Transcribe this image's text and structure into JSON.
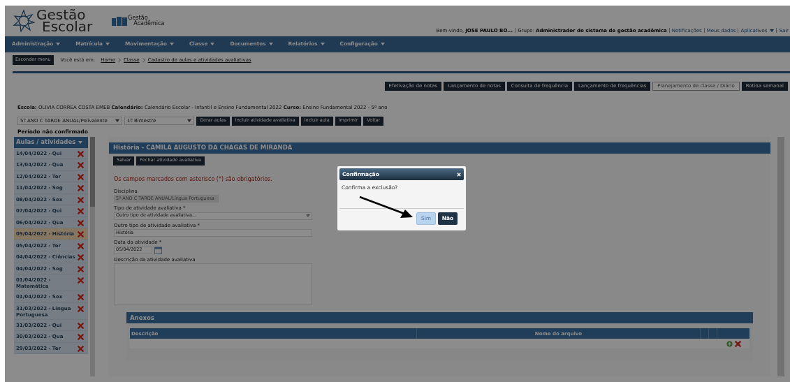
{
  "header": {
    "logo_line_1": "Gestão",
    "logo_line_2": "Escolar",
    "app_line_1": "Gestão",
    "app_line_2": "Acadêmica",
    "welcome_label": "Bem-vindo,",
    "user_name": "JOSE PAULO BO...",
    "group_label": "Grupo:",
    "group_name": "Administrador do sistema de gestão acadêmica",
    "links": [
      {
        "label": "Notificações",
        "dropdown": false
      },
      {
        "label": "Meus dados",
        "dropdown": false
      },
      {
        "label": "Aplicativos",
        "dropdown": true
      },
      {
        "label": "Sair",
        "dropdown": false
      }
    ]
  },
  "nav": [
    {
      "label": "Administração"
    },
    {
      "label": "Matrícula"
    },
    {
      "label": "Movimentação"
    },
    {
      "label": "Classe"
    },
    {
      "label": "Documentos"
    },
    {
      "label": "Relatórios"
    },
    {
      "label": "Configuração"
    }
  ],
  "breadcrumb": {
    "toggle_button": "Esconder menu",
    "prefix": "Você está em:",
    "items": [
      {
        "label": "Home"
      },
      {
        "label": "Classe"
      },
      {
        "label": "Cadastro de aulas e atividades avaliativas"
      }
    ]
  },
  "top_buttons": [
    {
      "label": "Efetivação de notas",
      "selected": false
    },
    {
      "label": "Lançamento de notas",
      "selected": false
    },
    {
      "label": "Consulta de frequência",
      "selected": false
    },
    {
      "label": "Lançamento de frequências",
      "selected": false
    },
    {
      "label": "Planejamento de classe / Diário",
      "selected": true
    },
    {
      "label": "Rotina semanal",
      "selected": false
    }
  ],
  "info_line": "**Escola:** OLIVIA CORREA COSTA EMEB **Calendário:** Calendário Escolar - Infantil e Ensino Fundamental 2022 **Curso:** Ensino Fundamental 2022 - 5º ano",
  "filters": {
    "class_select": "5º ANO C TARDE ANUAL/Polivalente",
    "period_select": "1º Bimestre",
    "buttons": [
      "Gerar aulas",
      "Incluir atividade avaliativa",
      "Incluir aula",
      "Imprimir",
      "Voltar"
    ]
  },
  "period_status": "Período não confirmado",
  "sidebar": {
    "title": "Aulas / atividades",
    "items": [
      {
        "label": "14/04/2022 - Qui",
        "selected": false
      },
      {
        "label": "13/04/2022 - Qua",
        "selected": false
      },
      {
        "label": "12/04/2022 - Ter",
        "selected": false
      },
      {
        "label": "11/04/2022 - Seg",
        "selected": false
      },
      {
        "label": "08/04/2022 - Sex",
        "selected": false
      },
      {
        "label": "07/04/2022 - Qui",
        "selected": false
      },
      {
        "label": "06/04/2022 - Qua",
        "selected": false
      },
      {
        "label": "05/04/2022 - História",
        "selected": true
      },
      {
        "label": "05/04/2022 - Ter",
        "selected": false
      },
      {
        "label": "04/04/2022 - Ciências",
        "selected": false
      },
      {
        "label": "04/04/2022 - Seg",
        "selected": false
      },
      {
        "label": "01/04/2022 - Matemática",
        "selected": false
      },
      {
        "label": "01/04/2022 - Sex",
        "selected": false
      },
      {
        "label": "31/03/2022 - Língua Portuguesa",
        "selected": false
      },
      {
        "label": "31/03/2022 - Qui",
        "selected": false
      },
      {
        "label": "30/03/2022 - Qua",
        "selected": false
      },
      {
        "label": "29/03/2022 - Ter",
        "selected": false
      }
    ]
  },
  "form": {
    "title": "História - CAMILA AUGUSTO DA CHAGAS DE MIRANDA",
    "buttons": [
      "Salvar",
      "Fechar atividade avaliativa"
    ],
    "required_note": "Os campos marcados com asterisco (*) são obrigatórios.",
    "fields": [
      {
        "kind": "select",
        "label": "Disciplina",
        "value": "5º ANO C TARDE ANUAL/Língua Portuguesa",
        "disabled": true
      },
      {
        "kind": "select",
        "label": "Tipo de atividade avaliativa *",
        "value": "Outro tipo de atividade avaliativa...",
        "disabled": false
      },
      {
        "kind": "text",
        "label": "Outro tipo de atividade avaliativa *",
        "value": "História",
        "disabled": false
      },
      {
        "kind": "date",
        "label": "Data da atividade *",
        "value": "05/04/2022",
        "disabled": false
      },
      {
        "kind": "textarea",
        "label": "Descrição da atividade avaliativa"
      }
    ]
  },
  "attachments": {
    "title": "Anexos",
    "columns": [
      "Descrição",
      "Nome do arquivo"
    ]
  },
  "dialog": {
    "title": "Confirmação",
    "message": "Confirma a exclusão?",
    "buttons": [
      {
        "label": "Sim",
        "kind": "light"
      },
      {
        "label": "Não",
        "kind": "dark"
      }
    ]
  }
}
